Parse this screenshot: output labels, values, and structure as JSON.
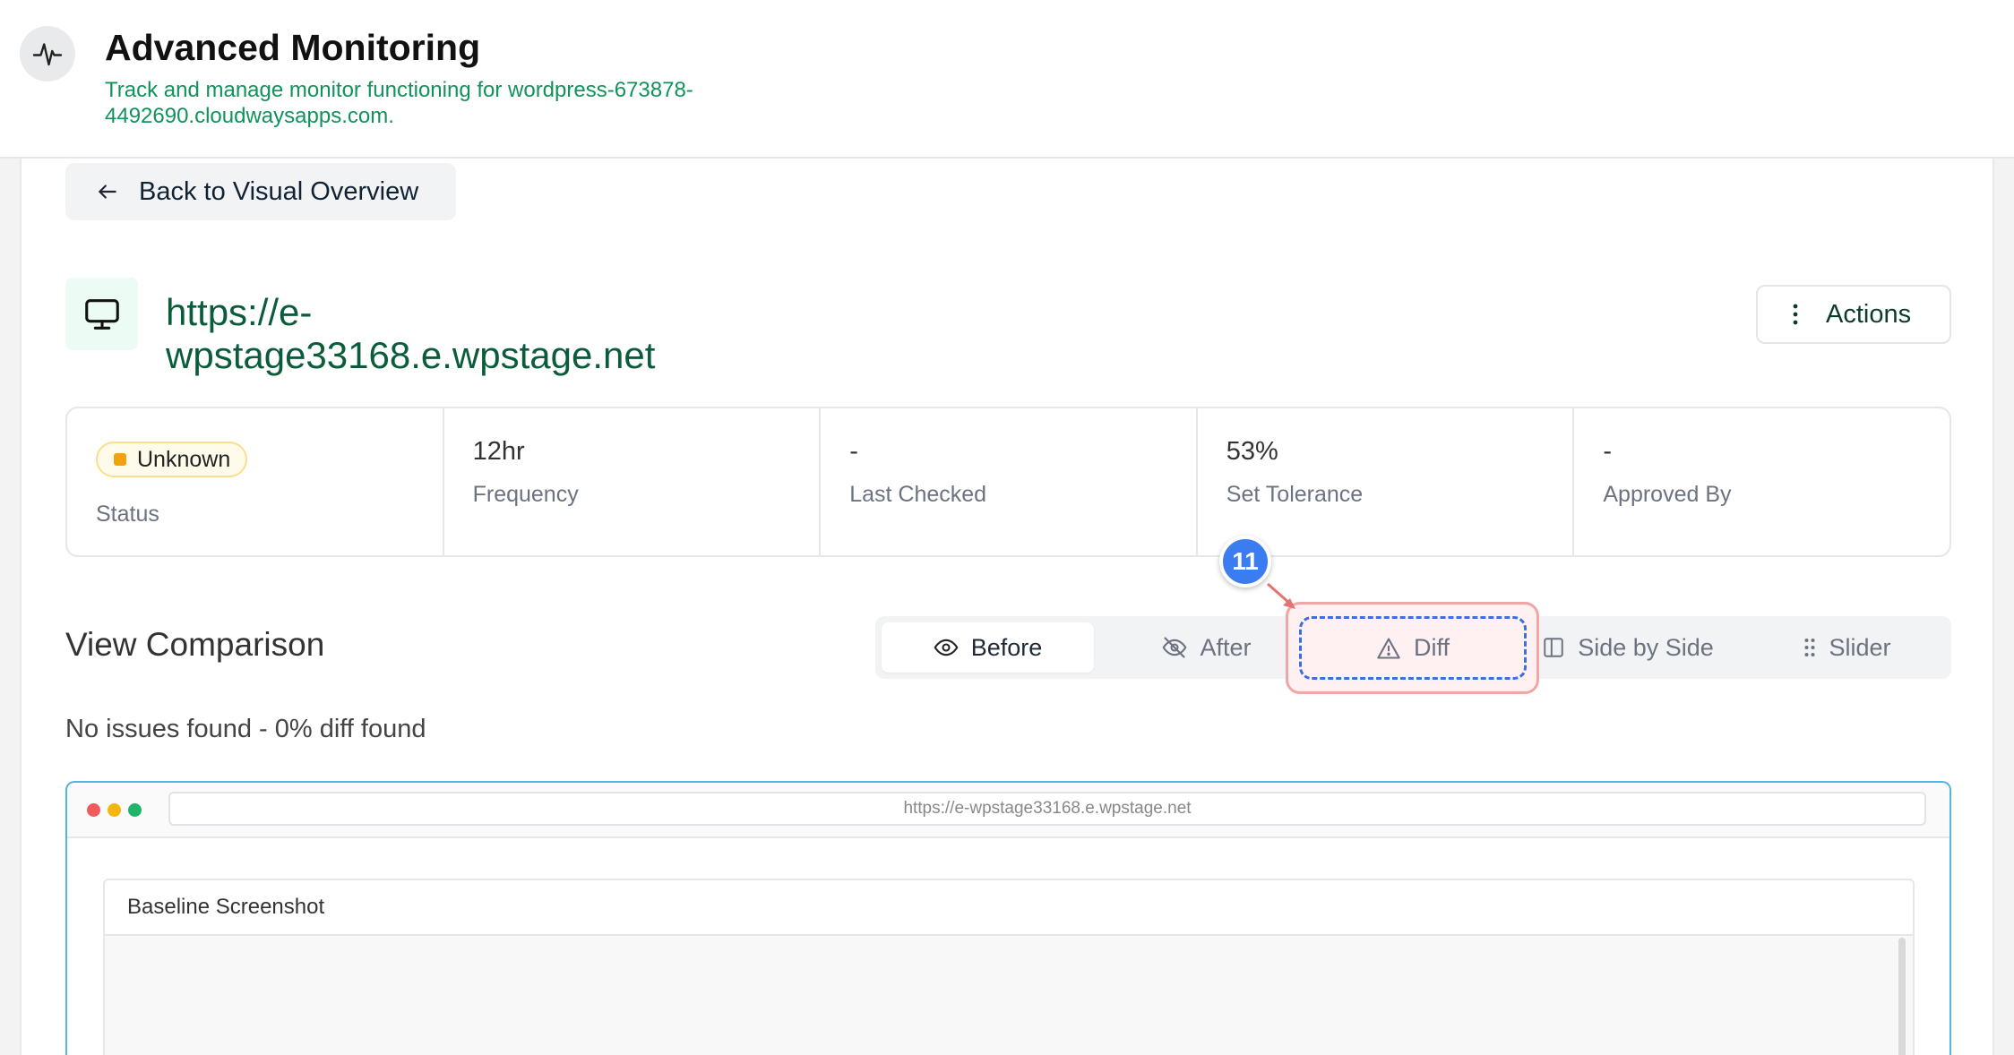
{
  "header": {
    "title": "Advanced Monitoring",
    "subtitle": "Track and manage monitor functioning for wordpress-673878-4492690.cloudwaysapps.com.",
    "logo_icon": "pulse-icon"
  },
  "nav": {
    "back_label": "Back to Visual Overview"
  },
  "monitor": {
    "url": "https://e-wpstage33168.e.wpstage.net",
    "actions_label": "Actions"
  },
  "stats": {
    "status_badge": "Unknown",
    "status_label": "Status",
    "frequency_value": "12hr",
    "frequency_label": "Frequency",
    "last_checked_value": "-",
    "last_checked_label": "Last Checked",
    "tolerance_value": "53%",
    "tolerance_label": "Set Tolerance",
    "approved_value": "-",
    "approved_label": "Approved By"
  },
  "comparison": {
    "title": "View Comparison",
    "tabs": {
      "before": "Before",
      "after": "After",
      "diff": "Diff",
      "side_by_side": "Side by Side",
      "slider": "Slider"
    },
    "active_tab": "Before",
    "summary": "No issues found - 0% diff found"
  },
  "annotation": {
    "marker": "11"
  },
  "browser": {
    "url": "https://e-wpstage33168.e.wpstage.net",
    "card_title": "Baseline Screenshot"
  },
  "colors": {
    "accent_green": "#10935a",
    "url_green": "#0b5c3a",
    "badge_amber": "#f4a20c",
    "marker_blue": "#3b7cf0",
    "frame_blue": "#4fb8dc"
  }
}
